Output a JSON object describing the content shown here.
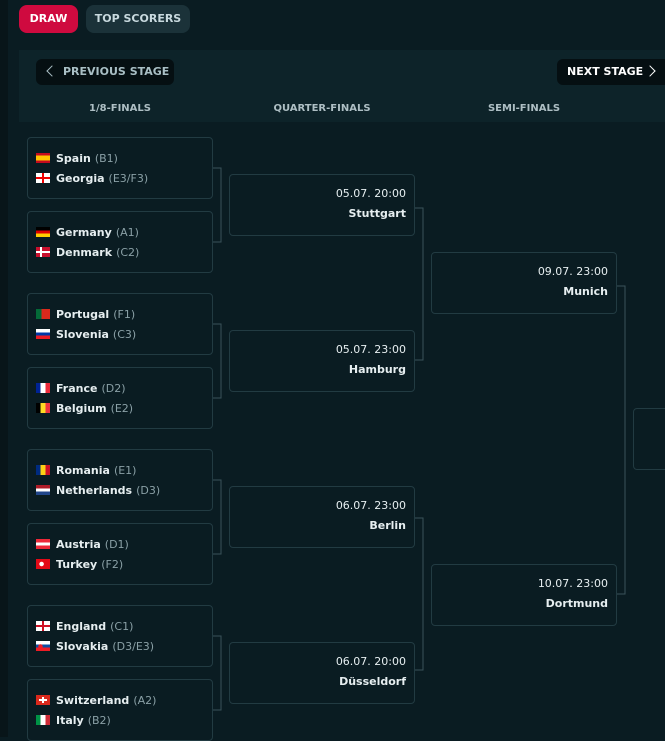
{
  "tabs": [
    {
      "label": "DRAW",
      "active": true
    },
    {
      "label": "TOP SCORERS",
      "active": false
    }
  ],
  "nav": {
    "previous_label": "PREVIOUS STAGE",
    "next_label": "NEXT STAGE"
  },
  "stages": [
    "1/8-FINALS",
    "QUARTER-FINALS",
    "SEMI-FINALS"
  ],
  "round_of_16": [
    {
      "teams": [
        {
          "name": "Spain",
          "seed": "(B1)",
          "flag": "spain-flag"
        },
        {
          "name": "Georgia",
          "seed": "(E3/F3)",
          "flag": "georgia-flag"
        }
      ]
    },
    {
      "teams": [
        {
          "name": "Germany",
          "seed": "(A1)",
          "flag": "germany-flag"
        },
        {
          "name": "Denmark",
          "seed": "(C2)",
          "flag": "denmark-flag"
        }
      ]
    },
    {
      "teams": [
        {
          "name": "Portugal",
          "seed": "(F1)",
          "flag": "portugal-flag"
        },
        {
          "name": "Slovenia",
          "seed": "(C3)",
          "flag": "slovenia-flag"
        }
      ]
    },
    {
      "teams": [
        {
          "name": "France",
          "seed": "(D2)",
          "flag": "france-flag"
        },
        {
          "name": "Belgium",
          "seed": "(E2)",
          "flag": "belgium-flag"
        }
      ]
    },
    {
      "teams": [
        {
          "name": "Romania",
          "seed": "(E1)",
          "flag": "romania-flag"
        },
        {
          "name": "Netherlands",
          "seed": "(D3)",
          "flag": "netherlands-flag"
        }
      ]
    },
    {
      "teams": [
        {
          "name": "Austria",
          "seed": "(D1)",
          "flag": "austria-flag"
        },
        {
          "name": "Turkey",
          "seed": "(F2)",
          "flag": "turkey-flag"
        }
      ]
    },
    {
      "teams": [
        {
          "name": "England",
          "seed": "(C1)",
          "flag": "england-flag"
        },
        {
          "name": "Slovakia",
          "seed": "(D3/E3)",
          "flag": "slovakia-flag"
        }
      ]
    },
    {
      "teams": [
        {
          "name": "Switzerland",
          "seed": "(A2)",
          "flag": "switzerland-flag"
        },
        {
          "name": "Italy",
          "seed": "(B2)",
          "flag": "italy-flag"
        }
      ]
    }
  ],
  "quarter_finals": [
    {
      "date": "05.07. 20:00",
      "city": "Stuttgart"
    },
    {
      "date": "05.07. 23:00",
      "city": "Hamburg"
    },
    {
      "date": "06.07. 23:00",
      "city": "Berlin"
    },
    {
      "date": "06.07. 20:00",
      "city": "Düsseldorf"
    }
  ],
  "semi_finals": [
    {
      "date": "09.07. 23:00",
      "city": "Munich"
    },
    {
      "date": "10.07. 23:00",
      "city": "Dortmund"
    }
  ],
  "colors": {
    "accent": "#cf0a3f",
    "background": "#0a1c22",
    "panel": "#0d2329",
    "card_border": "#223b42"
  }
}
